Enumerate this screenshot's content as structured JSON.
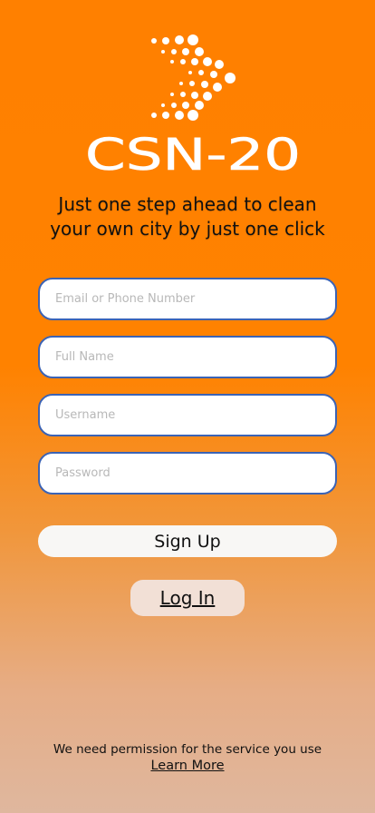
{
  "brand": {
    "name": "CSN-20",
    "logo_icon": "dotted-arrow-icon",
    "logo_color": "#ffffff"
  },
  "tagline": {
    "line1": "Just one step ahead to clean",
    "line2": "your own city by just one click"
  },
  "form": {
    "email_placeholder": "Email or Phone Number",
    "fullname_placeholder": "Full Name",
    "username_placeholder": "Username",
    "password_placeholder": "Password"
  },
  "actions": {
    "signup_label": "Sign Up",
    "login_label": "Log In"
  },
  "footer": {
    "permission_text": "We need permission for the service you use",
    "learn_more_label": "Learn More"
  },
  "colors": {
    "background_top": "#ff8000",
    "background_bottom": "#dfb79e",
    "field_border": "#3b63b5"
  }
}
